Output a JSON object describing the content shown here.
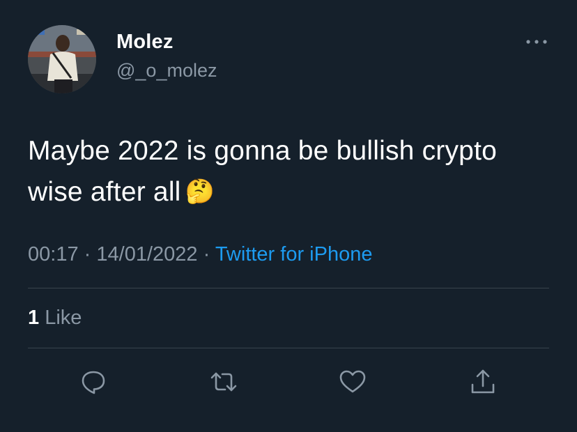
{
  "user": {
    "name": "Molez",
    "handle": "@_o_molez"
  },
  "tweet": {
    "text": "Maybe 2022 is gonna be bullish crypto wise after all",
    "emoji": "🤔"
  },
  "meta": {
    "time": "00:17",
    "separator": "·",
    "date": "14/01/2022",
    "source": "Twitter for iPhone"
  },
  "stats": {
    "like_count": "1",
    "like_label": "Like"
  },
  "icons": {
    "more": "more-options-icon",
    "reply": "reply-icon",
    "retweet": "retweet-icon",
    "like": "heart-icon",
    "share": "share-icon"
  },
  "colors": {
    "background": "#15202b",
    "muted": "#8b98a5",
    "accent": "#1d9bf0",
    "divider": "#38444d"
  }
}
